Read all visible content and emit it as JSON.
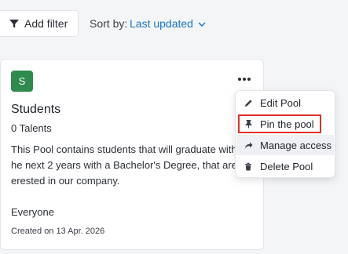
{
  "toolbar": {
    "add_filter_label": "Add filter",
    "sort_label": "Sort by:",
    "sort_value": "Last updated"
  },
  "card": {
    "avatar_letter": "S",
    "avatar_color": "#2f8a4e",
    "title": "Students",
    "talents": "0 Talents",
    "description_lines": [
      "This Pool contains students that will graduate with",
      "he next 2 years with a Bachelor's Degree, that are",
      "erested in our company."
    ],
    "audience": "Everyone",
    "created": "Created on 13 Apr. 2026"
  },
  "menu": {
    "items": [
      {
        "label": "Edit Pool",
        "icon": "pencil-icon"
      },
      {
        "label": "Pin the pool",
        "icon": "pin-icon"
      },
      {
        "label": "Manage access",
        "icon": "share-arrow-icon"
      },
      {
        "label": "Delete Pool",
        "icon": "trash-icon"
      }
    ]
  },
  "colors": {
    "accent": "#1a73c9",
    "highlight": "#e0302a"
  }
}
